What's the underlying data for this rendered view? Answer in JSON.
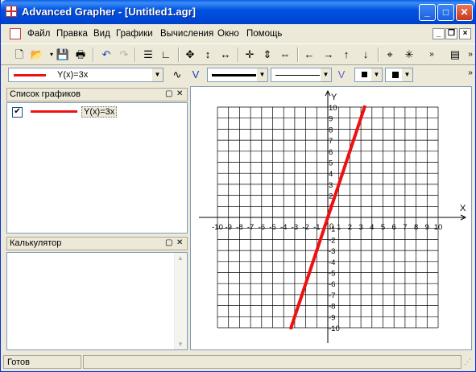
{
  "window": {
    "title": "Advanced Grapher - [Untitled1.agr]"
  },
  "menu": [
    "Файл",
    "Правка",
    "Вид",
    "Графики",
    "Вычисления",
    "Окно",
    "Помощь"
  ],
  "graph_toolbar": {
    "function_label": "Y(x)=3x"
  },
  "graph_list": {
    "title": "Список графиков",
    "items": [
      {
        "label": "Y(x)=3x",
        "checked": true,
        "color": "#ee1111"
      }
    ]
  },
  "calculator": {
    "title": "Калькулятор"
  },
  "axes": {
    "x_label": "X",
    "y_label": "Y",
    "x_ticks": [
      "-10",
      "-9",
      "-8",
      "-7",
      "-6",
      "-5",
      "-4",
      "-3",
      "-2",
      "-1",
      "1",
      "2",
      "3",
      "4",
      "5",
      "6",
      "7",
      "8",
      "9",
      "10"
    ],
    "y_ticks": [
      "10",
      "9",
      "8",
      "7",
      "6",
      "5",
      "4",
      "3",
      "2",
      "1",
      "-1",
      "-2",
      "-3",
      "-4",
      "-5",
      "-6",
      "-7",
      "-8",
      "-9",
      "-10"
    ],
    "origin_label": "0"
  },
  "chart_data": {
    "type": "line",
    "series": [
      {
        "name": "Y(x)=3x",
        "x": [
          -3.333,
          3.333
        ],
        "y": [
          -10,
          10
        ]
      }
    ],
    "xlim": [
      -10,
      10
    ],
    "ylim": [
      -10,
      10
    ],
    "xlabel": "X",
    "ylabel": "Y",
    "grid": true,
    "line_color": "#ee1111"
  },
  "status": {
    "text": "Готов"
  }
}
